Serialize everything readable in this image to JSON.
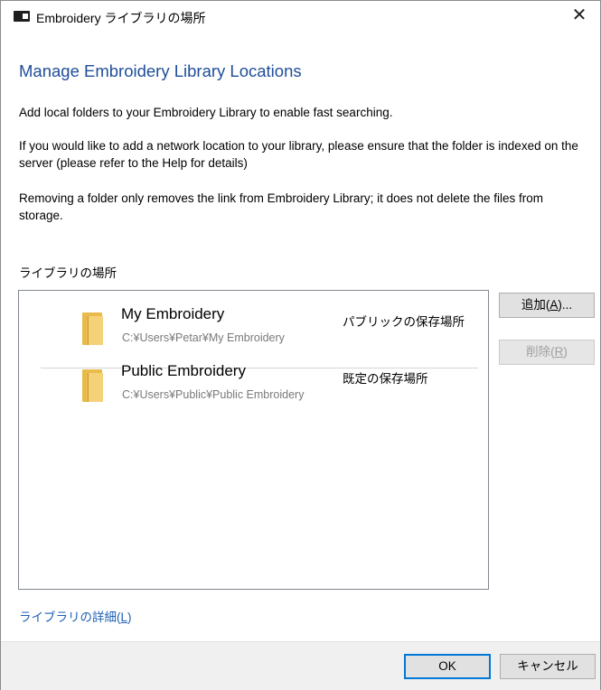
{
  "window": {
    "title": "Embroidery ライブラリの場所",
    "close_glyph": "✕",
    "app_icon": "embroidery-app-icon"
  },
  "heading": "Manage Embroidery Library Locations",
  "paragraphs": {
    "p1": "Add local folders to your Embroidery Library to enable fast searching.",
    "p2": "If you would like to add a network location to your library, please ensure that the folder is indexed on the server (please refer to the Help for details)",
    "p3": "Removing a folder only removes the link from Embroidery Library; it does not delete the files from storage."
  },
  "library": {
    "section_label": "ライブラリの場所",
    "items": [
      {
        "name": "My Embroidery",
        "path": "C:¥Users¥Petar¥My Embroidery",
        "type": "パブリックの保存場所",
        "icon": "folder-icon"
      },
      {
        "name": "Public Embroidery",
        "path": "C:¥Users¥Public¥Public Embroidery",
        "type": "既定の保存場所",
        "icon": "folder-icon"
      }
    ]
  },
  "buttons": {
    "add_prefix": "追加(",
    "add_key": "A",
    "add_suffix": ")...",
    "remove_prefix": "削除(",
    "remove_key": "R",
    "remove_suffix": ")",
    "ok": "OK",
    "cancel": "キャンセル"
  },
  "details_link": {
    "prefix": "ライブラリの詳細(",
    "key": "L",
    "suffix": ")"
  },
  "colors": {
    "heading": "#1f4e9a",
    "link": "#1e5fb4",
    "default_button_border": "#0078d7",
    "folder": "#f5d27a"
  }
}
